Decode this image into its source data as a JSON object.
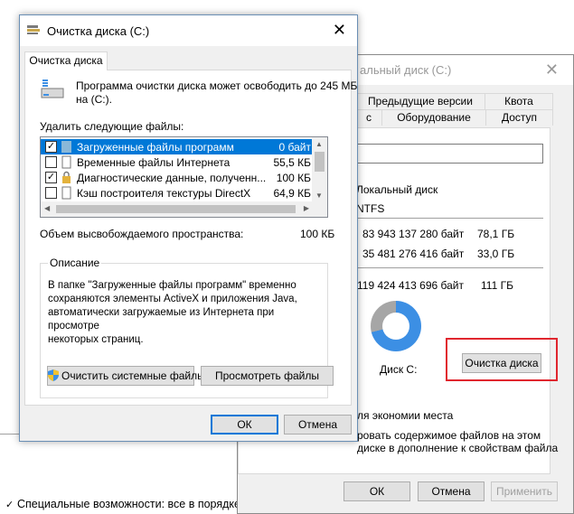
{
  "background": {
    "status_text": "Специальные возможности: все в порядке"
  },
  "properties_window": {
    "title": "альный диск (C:)",
    "tabs_top": [
      "Предыдущие версии",
      "Квота"
    ],
    "tabs_bottom": [
      "с",
      "Оборудование",
      "Доступ"
    ],
    "type_label": "Локальный диск",
    "filesystem": "NTFS",
    "used_bytes": "83 943 137 280 байт",
    "used_size": "78,1 ГБ",
    "free_bytes": "35 481 276 416 байт",
    "free_size": "33,0 ГБ",
    "capacity_bytes": "119 424 413 696 байт",
    "capacity_size": "111 ГБ",
    "drive_caption": "Диск C:",
    "cleanup_button": "Очистка диска",
    "compress_text": "ля экономии места",
    "index_text_1": "ровать содержимое файлов на этом",
    "index_text_2": "диске в дополнение к свойствам файла",
    "ok": "ОК",
    "cancel": "Отмена",
    "apply": "Применить",
    "colors": {
      "used": "#3c8fe4",
      "free": "#a6a6a6"
    }
  },
  "disk_cleanup": {
    "title": "Очистка диска  (C:)",
    "tab": "Очистка диска",
    "intro": "Программа очистки диска может освободить до 245 МБ на  (C:).",
    "intro_line1": "Программа очистки диска может освободить до 245 МБ",
    "intro_line2": "на  (C:).",
    "delete_label": "Удалить следующие файлы:",
    "files": [
      {
        "name": "Загруженные файлы программ",
        "size": "0 байт",
        "checked": true,
        "selected": true
      },
      {
        "name": "Временные файлы Интернета",
        "size": "55,5 КБ",
        "checked": false,
        "selected": false
      },
      {
        "name": "Диагностические данные, полученн...",
        "size": "100 КБ",
        "checked": true,
        "selected": false
      },
      {
        "name": "Кэш построителя текстуры DirectX",
        "size": "64,9 КБ",
        "checked": false,
        "selected": false
      }
    ],
    "freed_label": "Объем высвобождаемого пространства:",
    "freed_value": "100 КБ",
    "description_legend": "Описание",
    "description": "В папке \"Загруженные файлы программ\" временно\nсохраняются элементы ActiveX и приложения Java,\nавтоматически загружаемые из Интернета при просмотре\nнекоторых страниц.",
    "clean_system_button": "Очистить системные файлы",
    "view_files_button": "Просмотреть файлы",
    "ok": "ОК",
    "cancel": "Отмена"
  }
}
